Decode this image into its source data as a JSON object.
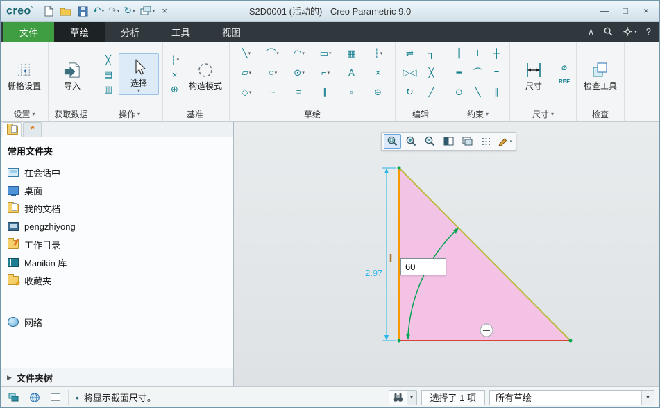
{
  "window": {
    "logo": "creo",
    "logo_mark": "°",
    "title": "S2D0001 (活动的) - Creo Parametric 9.0",
    "minimize": "—",
    "maximize": "□",
    "close": "×"
  },
  "glyphs": {
    "dropdown": "▾",
    "collapse": "∧",
    "help": "?",
    "bullet": "•",
    "footer_arrow": "▶",
    "combo_arrow": "▼"
  },
  "quick_access": {
    "undo": "↶",
    "redo": "↷",
    "regenerate": "↻",
    "close_window": "×"
  },
  "ribbon": {
    "tabs": [
      {
        "name": "tab-file",
        "label": "文件",
        "cls": "file"
      },
      {
        "name": "tab-sketch",
        "label": "草绘",
        "cls": "active"
      },
      {
        "name": "tab-analysis",
        "label": "分析",
        "cls": ""
      },
      {
        "name": "tab-tools",
        "label": "工具",
        "cls": ""
      },
      {
        "name": "tab-view",
        "label": "视图",
        "cls": ""
      }
    ],
    "groups": {
      "settings": {
        "label": "设置",
        "arrow": "▾",
        "button_label": "栅格设置"
      },
      "get_data": {
        "label": "获取数据",
        "arrow": "",
        "button_label": "导入"
      },
      "operations": {
        "label": "操作",
        "arrow": "▾",
        "button_label": "选择",
        "minis": [
          {
            "name": "cut-button",
            "g": "╳"
          },
          {
            "name": "copy-button",
            "g": "▤"
          },
          {
            "name": "paste-button",
            "g": "▥"
          }
        ]
      },
      "datum": {
        "label": "基准",
        "arrow": "",
        "button_label": "构造模式",
        "minis": [
          {
            "name": "centerline-button",
            "g": "┆",
            "a": "▾"
          },
          {
            "name": "point-button",
            "g": "×"
          },
          {
            "name": "csys-button",
            "g": "⊕"
          }
        ]
      },
      "sketch": {
        "label": "草绘",
        "tools": [
          {
            "name": "line-tool",
            "g": "╲",
            "a": "▾"
          },
          {
            "name": "arc-tool",
            "g": "⌒",
            "a": "▾"
          },
          {
            "name": "ellipse-tool",
            "g": "◠",
            "a": "▾"
          },
          {
            "name": "rectangle-tool",
            "g": "▭",
            "a": "▾"
          },
          {
            "name": "palette-tool",
            "g": "▦",
            "a": ""
          },
          {
            "name": "centerline-tool",
            "g": "┆",
            "a": "▾"
          },
          {
            "name": "slanted-rectangle-tool",
            "g": "▱",
            "a": "▾"
          },
          {
            "name": "circle-tool",
            "g": "○",
            "a": "▾"
          },
          {
            "name": "concentric-circle-tool",
            "g": "⊙",
            "a": "▾"
          },
          {
            "name": "fillet-tool",
            "g": "⌐",
            "a": "▾"
          },
          {
            "name": "text-tool",
            "g": "A",
            "a": ""
          },
          {
            "name": "point-tool",
            "g": "×",
            "a": ""
          },
          {
            "name": "rhombus-tool",
            "g": "◇",
            "a": "▾"
          },
          {
            "name": "spline-tool",
            "g": "~",
            "a": ""
          },
          {
            "name": "offset-tool",
            "g": "≡",
            "a": ""
          },
          {
            "name": "parallel-tool",
            "g": "∥",
            "a": ""
          },
          {
            "name": "project-tool",
            "g": "▫",
            "a": ""
          },
          {
            "name": "coordinate-tool",
            "g": "⊕",
            "a": ""
          }
        ]
      },
      "edit": {
        "label": "编辑",
        "tools": [
          {
            "name": "modify-tool",
            "g": "⇌",
            "a": ""
          },
          {
            "name": "corner-tool",
            "g": "┐",
            "a": ""
          },
          {
            "name": "mirror-tool",
            "g": "▷◁",
            "a": ""
          },
          {
            "name": "delete-segment-tool",
            "g": "╳",
            "a": ""
          },
          {
            "name": "rotate-resize-tool",
            "g": "↻",
            "a": ""
          },
          {
            "name": "divide-tool",
            "g": "╱",
            "a": ""
          }
        ]
      },
      "constrain": {
        "label": "约束",
        "arrow": "▾",
        "tools": [
          {
            "name": "vertical-constraint",
            "g": "┃",
            "a": ""
          },
          {
            "name": "perpendicular-constraint",
            "g": "⊥",
            "a": ""
          },
          {
            "name": "midpoint-constraint",
            "g": "┼",
            "a": ""
          },
          {
            "name": "horizontal-constraint",
            "g": "━",
            "a": ""
          },
          {
            "name": "tangent-constraint",
            "g": "⌒",
            "a": ""
          },
          {
            "name": "equal-constraint",
            "g": "=",
            "a": ""
          },
          {
            "name": "coincident-constraint",
            "g": "⊙",
            "a": ""
          },
          {
            "name": "symmetric-constraint",
            "g": "╲",
            "a": ""
          },
          {
            "name": "parallel-constraint",
            "g": "∥",
            "a": ""
          }
        ]
      },
      "dimension": {
        "label": "尺寸",
        "arrow": "▾",
        "button_label": "尺寸",
        "minis": [
          {
            "name": "perimeter-dimension-button",
            "g": "⌀"
          },
          {
            "name": "baseline-dimension-button",
            "g": "REF"
          }
        ]
      },
      "inspect": {
        "label": "检查",
        "arrow": "",
        "button_label": "检查工具"
      }
    }
  },
  "navigator": {
    "header": "常用文件夹",
    "items": [
      {
        "name": "nav-item-in-session",
        "label": "在会话中",
        "icon": "session"
      },
      {
        "name": "nav-item-desktop",
        "label": "桌面",
        "icon": "desktop"
      },
      {
        "name": "nav-item-documents",
        "label": "我的文档",
        "icon": "documents"
      },
      {
        "name": "nav-item-user",
        "label": "pengzhiyong",
        "icon": "computer"
      },
      {
        "name": "nav-item-workdir",
        "label": "工作目录",
        "icon": "workdir"
      },
      {
        "name": "nav-item-manikin",
        "label": "Manikin 库",
        "icon": "library"
      },
      {
        "name": "nav-item-favorites",
        "label": "收藏夹",
        "icon": "favorites"
      }
    ],
    "network": {
      "label": "网络"
    },
    "footer": "文件夹树"
  },
  "canvas": {
    "dimension_value": "2.97",
    "angle_value": "60",
    "colors": {
      "fill": "#f4bfe4",
      "left_edge": "#f59b00",
      "bottom_edge": "#d84335",
      "hypotenuse": "#b9ba3a",
      "dimension": "#29b6e8",
      "constraint_arc": "#00a651"
    }
  },
  "status": {
    "message": "将显示截面尺寸。",
    "selection_count": "选择了 1 项",
    "filter_value": "所有草绘"
  }
}
